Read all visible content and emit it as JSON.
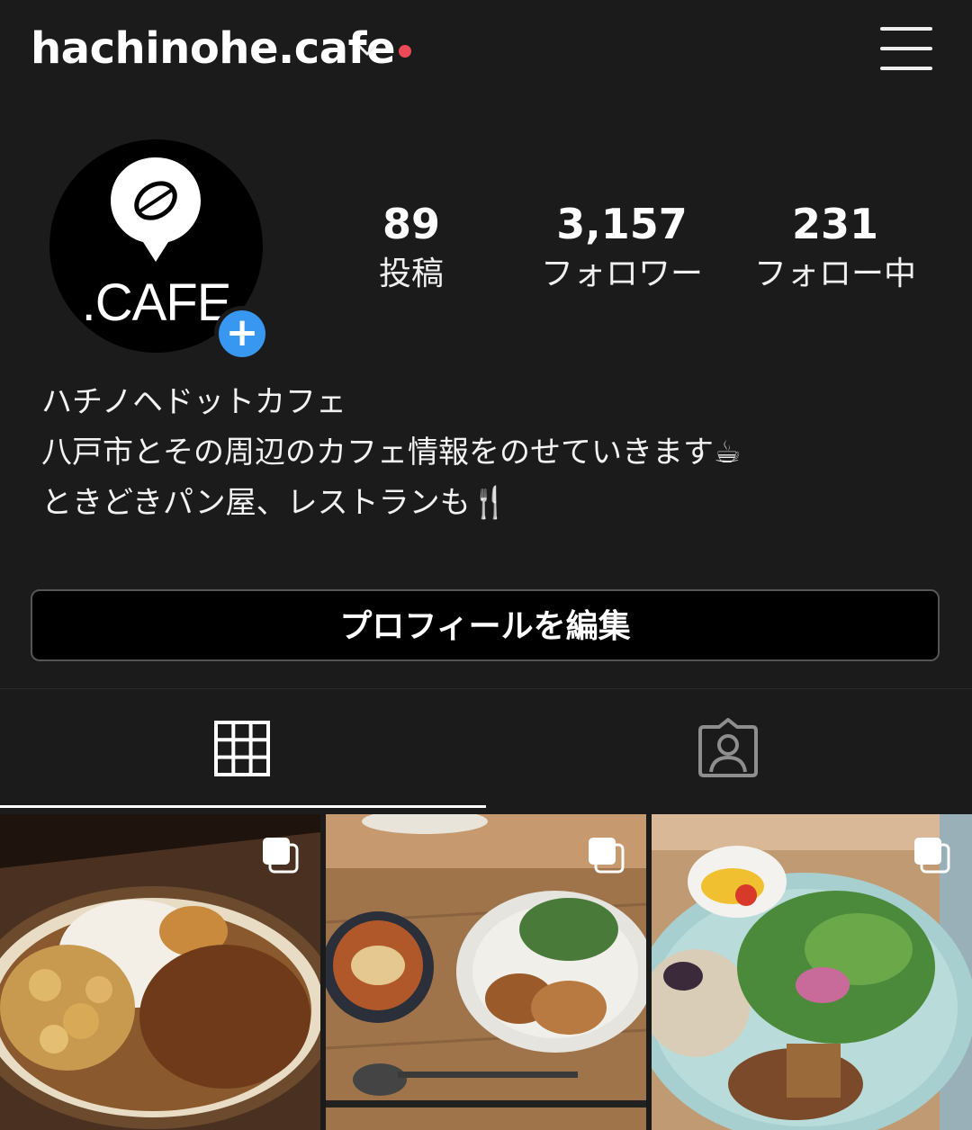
{
  "header": {
    "username": "hachinohe.cafe",
    "has_notification_dot": true
  },
  "profile": {
    "avatar_text": ".CAFE",
    "stats": [
      {
        "value": "89",
        "label": "投稿"
      },
      {
        "value": "3,157",
        "label": "フォロワー"
      },
      {
        "value": "231",
        "label": "フォロー中"
      }
    ],
    "bio": [
      "ハチノヘドットカフェ",
      "八戸市とその周辺のカフェ情報をのせていきます☕",
      "ときどきパン屋、レストランも🍴"
    ],
    "edit_button_label": "プロフィールを編集"
  },
  "tabs": [
    {
      "icon": "grid-icon",
      "active": true
    },
    {
      "icon": "tagged-icon",
      "active": false
    }
  ],
  "posts": [
    {
      "description": "curry rice bowl",
      "multi": true
    },
    {
      "description": "soup, bread and salad plate",
      "multi": true
    },
    {
      "description": "salad plate with rice",
      "multi": true
    }
  ],
  "colors": {
    "background": "#1b1b1b",
    "accent_blue": "#3897f0",
    "notification_red": "#ed4956"
  }
}
